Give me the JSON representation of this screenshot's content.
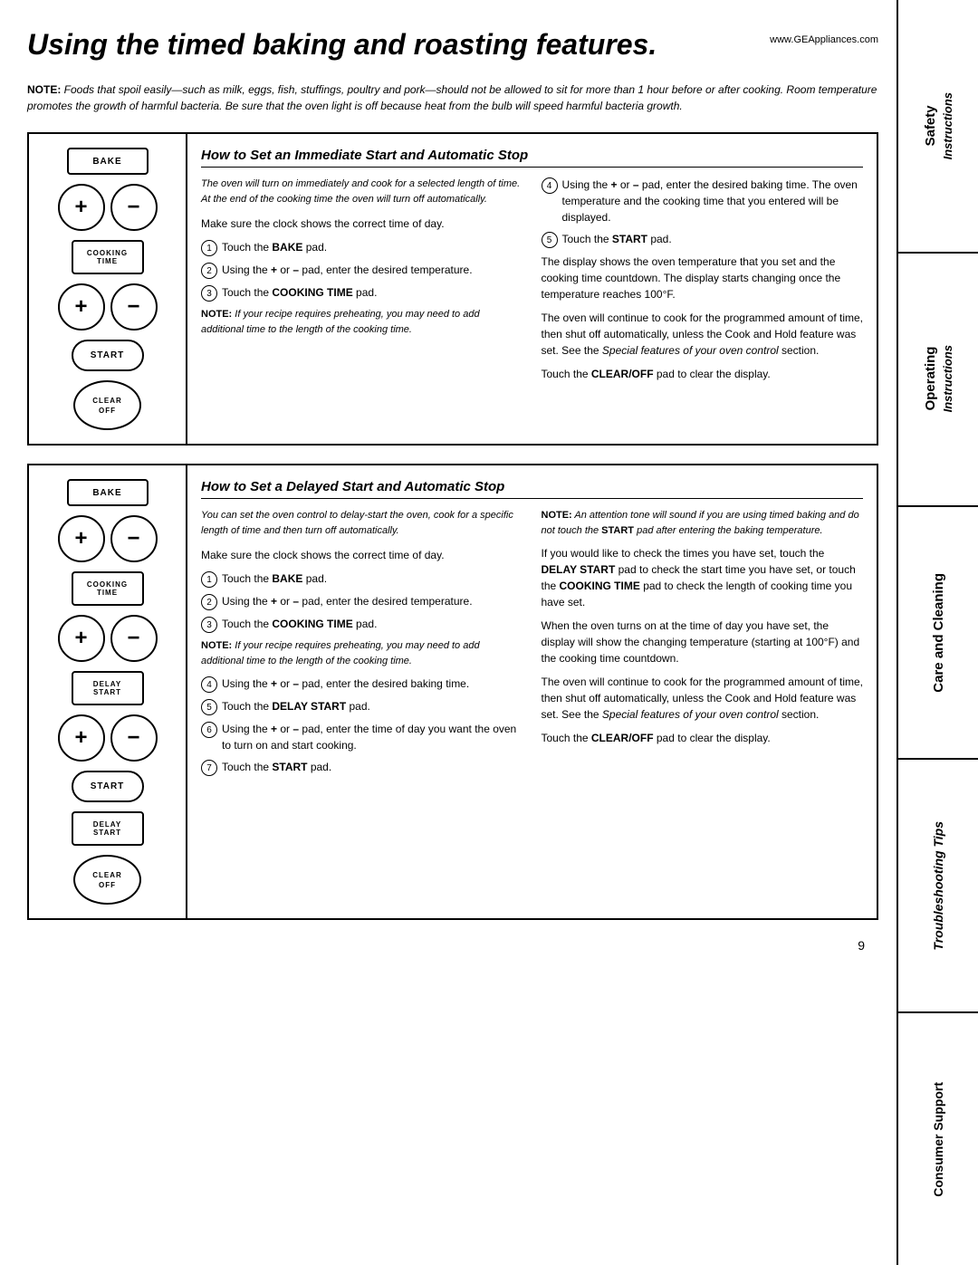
{
  "page": {
    "title": "Using the timed baking and roasting features.",
    "website": "www.GEAppliances.com",
    "page_number": "9",
    "note_intro": "NOTE:",
    "note_body": " Foods that spoil easily—such as milk, eggs, fish, stuffings, poultry and pork—should not be allowed to sit for more than 1 hour before or after cooking. Room temperature promotes the growth of harmful bacteria. Be sure that the oven light is off because heat from the bulb will speed harmful bacteria growth."
  },
  "sidebar": {
    "section1_line1": "Safety",
    "section1_line2": "Instructions",
    "section2_line1": "Operating",
    "section2_line2": "Instructions",
    "section3_line1": "Care and Cleaning",
    "section4_line1": "Troubleshooting Tips",
    "section5_line1": "Consumer Support"
  },
  "section1": {
    "title": "How to Set an Immediate Start and Automatic Stop",
    "intro": "The oven will turn on immediately and cook for a selected length of time. At the end of the cooking time the oven will turn off automatically.",
    "make_sure": "Make sure the clock shows the correct time of day.",
    "steps": [
      {
        "num": "1",
        "text": "Touch the BAKE pad."
      },
      {
        "num": "2",
        "text": "Using the + or – pad, enter the desired temperature."
      },
      {
        "num": "3",
        "text": "Touch the COOKING TIME pad."
      },
      {
        "num": "4",
        "text": "Using the + or – pad, enter the desired baking time. The oven temperature and the cooking time that you entered will be displayed."
      },
      {
        "num": "5",
        "text": "Touch the START pad."
      }
    ],
    "note_preheating": "NOTE: If your recipe requires preheating, you may need to add additional time to the length of the cooking time.",
    "display_text1": "The display shows the oven temperature that you set and the cooking time countdown. The display starts changing once the temperature reaches 100°F.",
    "display_text2": "The oven will continue to cook for the programmed amount of time, then shut off automatically, unless the Cook and Hold feature was set. See the Special features of your oven control section.",
    "clear_text": "Touch the CLEAR/OFF pad to clear the display.",
    "buttons": {
      "bake": "BAKE",
      "cooking_time_line1": "COOKING",
      "cooking_time_line2": "TIME",
      "start": "START",
      "clear_line1": "CLEAR",
      "clear_line2": "OFF"
    }
  },
  "section2": {
    "title": "How to Set a Delayed Start and Automatic Stop",
    "intro": "You can set the oven control to delay-start the oven, cook for a specific length of time and then turn off automatically.",
    "make_sure": "Make sure the clock shows the correct time of day.",
    "steps": [
      {
        "num": "1",
        "text": "Touch the BAKE pad."
      },
      {
        "num": "2",
        "text": "Using the + or – pad, enter the desired temperature."
      },
      {
        "num": "3",
        "text": "Touch the COOKING TIME pad."
      },
      {
        "num": "4",
        "text": "Using the + or – pad, enter the desired baking time."
      },
      {
        "num": "5",
        "text": "Touch the DELAY START pad."
      },
      {
        "num": "6",
        "text": "Using the + or – pad, enter the time of day you want the oven to turn on and start cooking."
      },
      {
        "num": "7",
        "text": "Touch the START pad."
      }
    ],
    "note_preheating": "NOTE: If your recipe requires preheating, you may need to add additional time to the length of the cooking time.",
    "note_start": "NOTE: An attention tone will sound if you are using timed baking and do not touch the START pad after entering the baking temperature.",
    "check_times": "If you would like to check the times you have set, touch the DELAY START pad to check the start time you have set, or touch the COOKING TIME pad to check the length of cooking time you have set.",
    "when_oven": "When the oven turns on at the time of day you have set, the display will show the changing temperature (starting at 100°F) and the cooking time countdown.",
    "continue_cook": "The oven will continue to cook for the programmed amount of time, then shut off automatically, unless the Cook and Hold feature was set. See the Special features of your oven control section.",
    "clear_text": "Touch the CLEAR/OFF pad to clear the display.",
    "buttons": {
      "bake": "BAKE",
      "cooking_time_line1": "COOKING",
      "cooking_time_line2": "TIME",
      "delay_start_line1": "DELAY",
      "delay_start_line2": "START",
      "start": "START",
      "clear_line1": "CLEAR",
      "clear_line2": "OFF"
    }
  }
}
